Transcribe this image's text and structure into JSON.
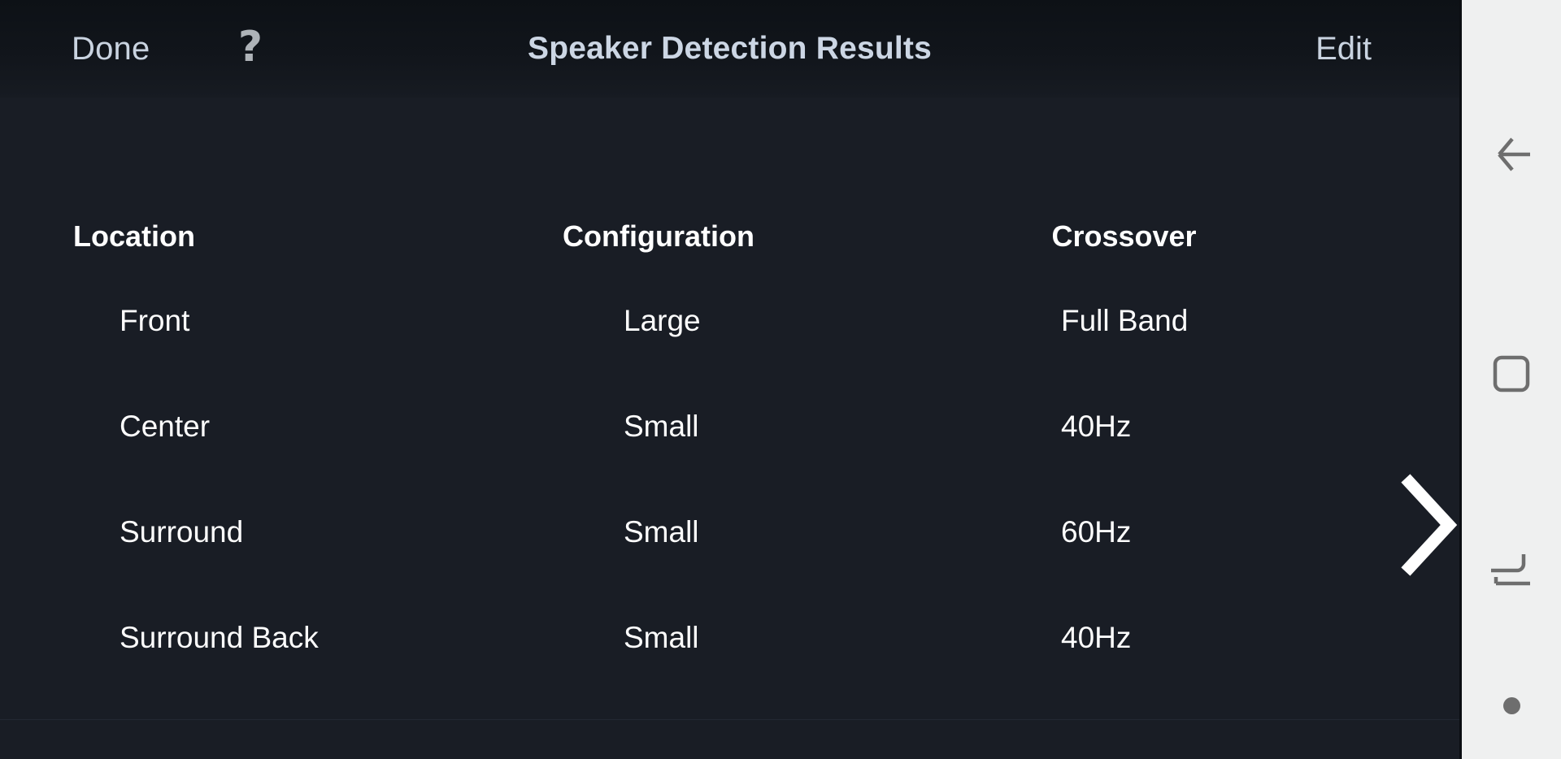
{
  "window": {
    "app_background": "#191d25",
    "topbar_background": "#0f131a",
    "system_nav_background": "#eff0f0"
  },
  "topbar": {
    "done_label": "Done",
    "help_icon": "question-mark-icon",
    "help_glyph": "?",
    "title": "Speaker Detection Results",
    "edit_label": "Edit",
    "text_color": "#c9d3e0"
  },
  "table": {
    "columns": [
      "Location",
      "Configuration",
      "Crossover"
    ],
    "rows": [
      {
        "location": "Front",
        "configuration": "Large",
        "crossover": "Full Band"
      },
      {
        "location": "Center",
        "configuration": "Small",
        "crossover": "40Hz"
      },
      {
        "location": "Surround",
        "configuration": "Small",
        "crossover": "60Hz"
      },
      {
        "location": "Surround Back",
        "configuration": "Small",
        "crossover": "40Hz"
      }
    ]
  },
  "pager": {
    "next_icon": "chevron-right-icon",
    "next_color": "#ffffff"
  },
  "system_nav": {
    "items": [
      {
        "name": "back-icon",
        "label": "Back"
      },
      {
        "name": "home-icon",
        "label": "Home"
      },
      {
        "name": "recents-icon",
        "label": "Recents"
      },
      {
        "name": "more-dot-icon",
        "label": "More"
      }
    ],
    "icon_color": "#6e6e6e"
  }
}
